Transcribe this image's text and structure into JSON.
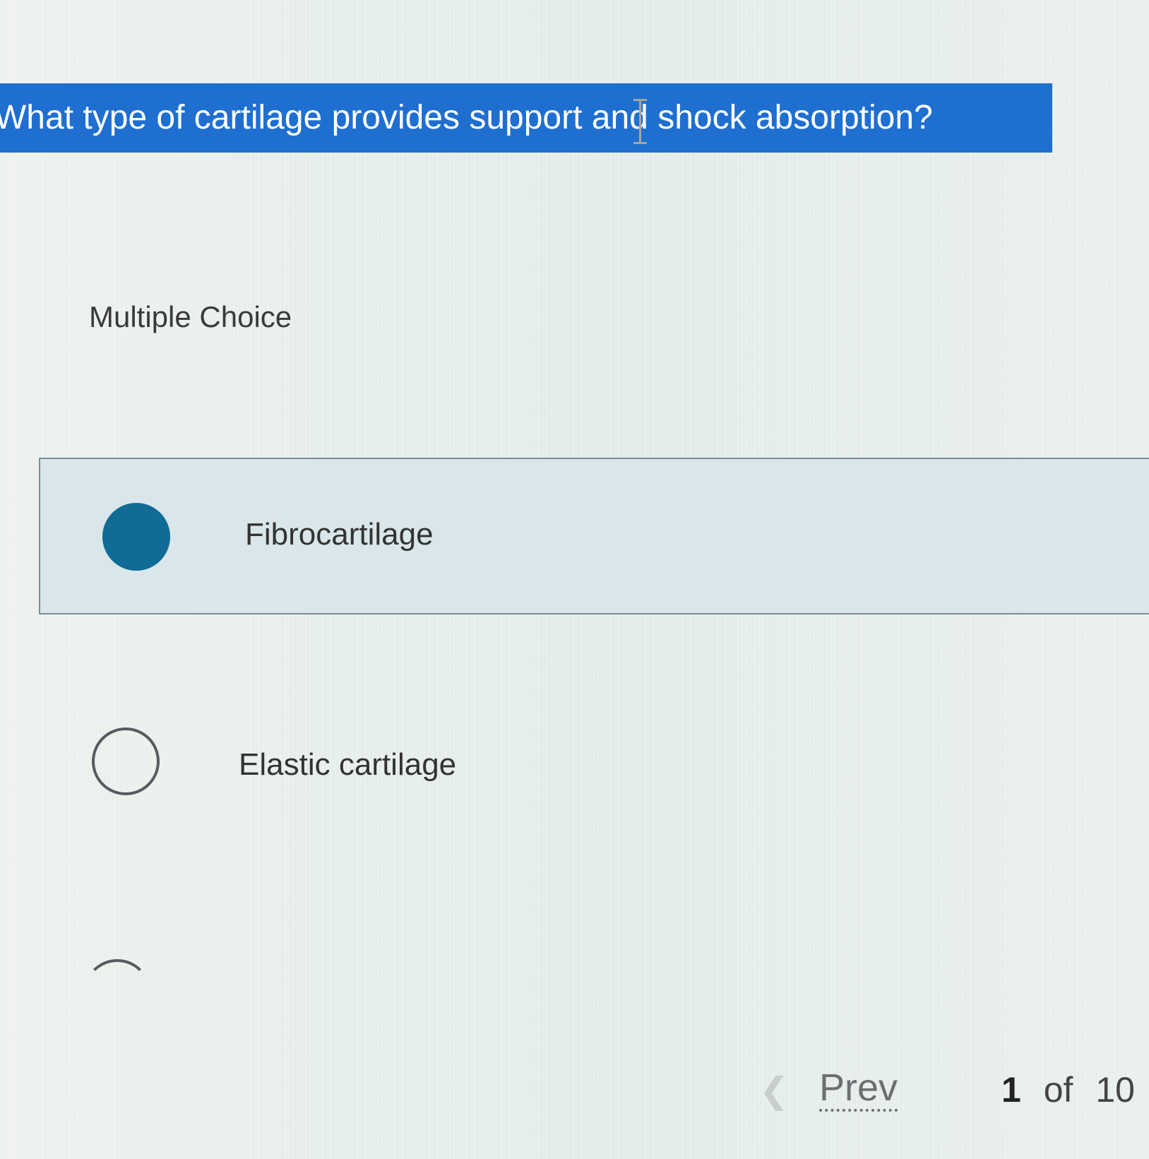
{
  "question": {
    "text": "What type of cartilage provides support and shock absorption?",
    "highlight_color": "#1f6fd1"
  },
  "question_type": {
    "label": "Multiple Choice"
  },
  "options": [
    {
      "label": "Fibrocartilage",
      "selected": true
    },
    {
      "label": "Elastic cartilage",
      "selected": false
    }
  ],
  "colors": {
    "selected_radio": "#106b97",
    "selected_row_bg": "#d9e6ea"
  },
  "navigation": {
    "prev_label": "Prev",
    "prev_icon": "chevron-left-icon",
    "current_page": "1",
    "of_label": "of",
    "total_pages": "10"
  }
}
